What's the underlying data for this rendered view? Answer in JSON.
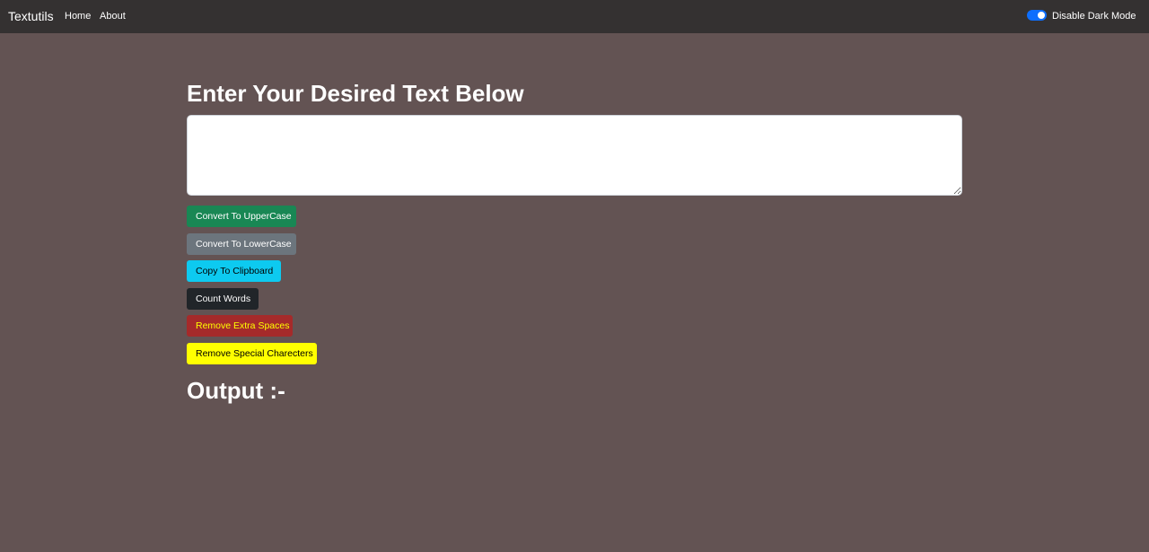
{
  "navbar": {
    "brand": "Textutils",
    "links": [
      {
        "label": "Home"
      },
      {
        "label": "About"
      }
    ],
    "mode_toggle": {
      "label": "Disable Dark Mode",
      "checked": true
    }
  },
  "main": {
    "heading": "Enter Your Desired Text Below",
    "textarea": {
      "value": "",
      "placeholder": ""
    },
    "buttons": {
      "uppercase": "Convert To UpperCase",
      "lowercase": "Convert To LowerCase",
      "copy": "Copy To Clipboard",
      "count_words": "Count Words",
      "remove_spaces": "Remove Extra Spaces",
      "remove_special": "Remove Special Charecters"
    },
    "output_heading": "Output :-"
  },
  "colors": {
    "page_background": "#635353",
    "navbar_background": "#343131",
    "toggle_accent": "#0d6efd",
    "uppercase_button": "#198754",
    "lowercase_button": "#6c757d",
    "copy_button": "#0dcaf0",
    "count_button": "#212529",
    "remove_spaces_button": "#a52a2a",
    "remove_spaces_text": "#ffff00",
    "remove_special_button": "#ffff00"
  }
}
